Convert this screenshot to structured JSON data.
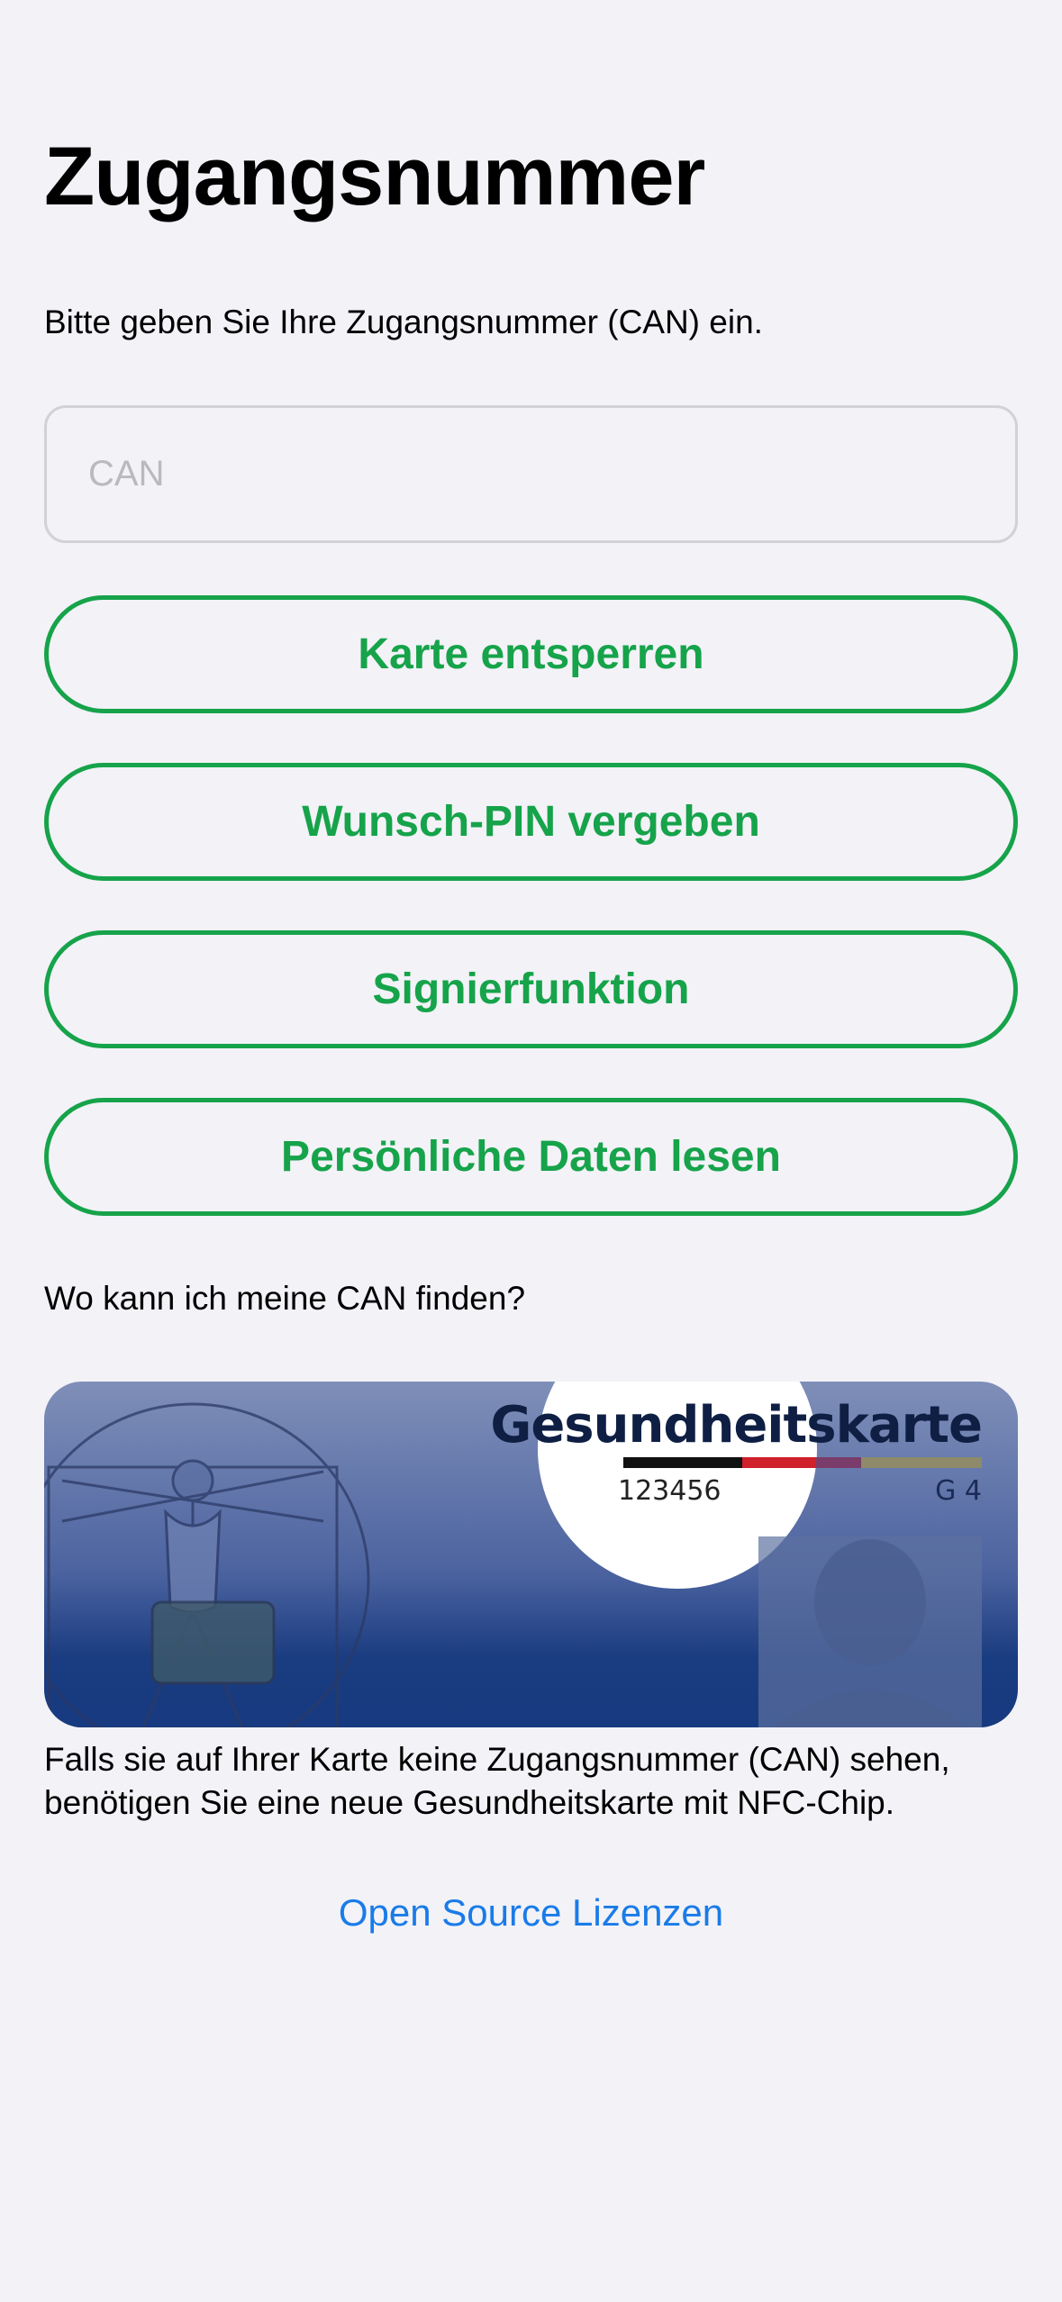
{
  "header": {
    "title": "Zugangsnummer",
    "subtitle": "Bitte geben Sie Ihre Zugangsnummer (CAN) ein."
  },
  "can_input": {
    "placeholder": "CAN",
    "value": ""
  },
  "actions": {
    "unlock_label": "Karte entsperren",
    "set_pin_label": "Wunsch-PIN vergeben",
    "sign_label": "Signierfunktion",
    "read_data_label": "Persönliche Daten lesen"
  },
  "help": {
    "question": "Wo kann ich meine CAN finden?",
    "card": {
      "title": "Gesundheitskarte",
      "number": "123456",
      "version": "G 4"
    },
    "hint": "Falls sie auf Ihrer Karte keine Zugangsnummer (CAN) sehen, benötigen Sie eine neue Gesundheitskarte mit NFC-Chip."
  },
  "footer": {
    "oss_link": "Open Source Lizenzen"
  },
  "colors": {
    "accent_green": "#16a34a",
    "link_blue": "#1a7be8",
    "background": "#f2f2f7",
    "card_blue": "#173a80"
  },
  "icons": {
    "card_illustration": "health-card-illustration"
  }
}
